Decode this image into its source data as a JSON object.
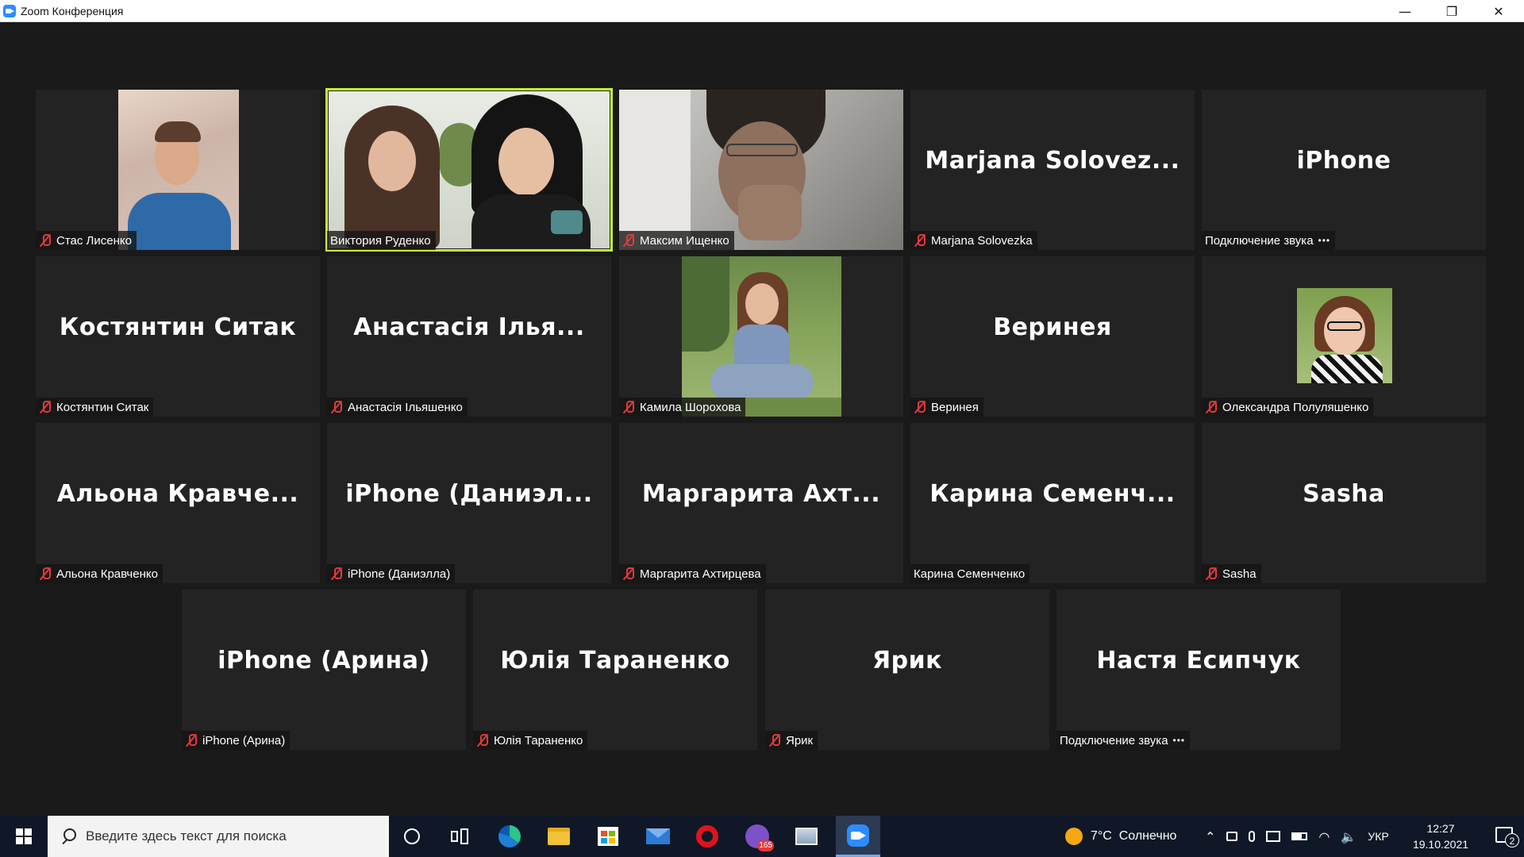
{
  "window": {
    "title": "Zoom Конференция",
    "minimize": "—",
    "restore": "❐",
    "close": "✕"
  },
  "accent_colors": {
    "active_speaker_border": "#c6f23a",
    "muted_icon": "#e5383b",
    "tile_bg": "#232323",
    "stage_bg": "#1a1a1a"
  },
  "tiles": [
    {
      "display_name": "",
      "label": "Стас Лисенко",
      "muted": true,
      "video": true
    },
    {
      "display_name": "",
      "label": "Виктория Руденко",
      "muted": false,
      "video": true,
      "active": true
    },
    {
      "display_name": "",
      "label": "Максим Ищенко",
      "muted": true,
      "video": true
    },
    {
      "display_name": "Marjana  Solovez...",
      "label": "Marjana Solovezka",
      "muted": true,
      "video": false
    },
    {
      "display_name": "iPhone",
      "label": "Подключение звука",
      "muted": false,
      "video": false,
      "connecting": true
    },
    {
      "display_name": "Костянтин Ситак",
      "label": "Костянтин Ситак",
      "muted": true,
      "video": false
    },
    {
      "display_name": "Анастасія Ілья...",
      "label": "Анастасія Ільяшенко",
      "muted": true,
      "video": false
    },
    {
      "display_name": "",
      "label": "Камила Шорохова",
      "muted": true,
      "video": true
    },
    {
      "display_name": "Веринея",
      "label": "Веринея",
      "muted": true,
      "video": false
    },
    {
      "display_name": "",
      "label": "Олександра Полуляшенко",
      "muted": true,
      "video": false,
      "avatar": true
    },
    {
      "display_name": "Альона  Кравче...",
      "label": "Альона Кравченко",
      "muted": true,
      "video": false
    },
    {
      "display_name": "iPhone  (Даниэл...",
      "label": "iPhone (Даниэлла)",
      "muted": true,
      "video": false
    },
    {
      "display_name": "Маргарита  Ахт...",
      "label": "Маргарита Ахтирцева",
      "muted": true,
      "video": false
    },
    {
      "display_name": "Карина  Семенч...",
      "label": "Карина Семенченко",
      "muted": false,
      "video": false
    },
    {
      "display_name": "Sasha",
      "label": "Sasha",
      "muted": true,
      "video": false
    },
    {
      "display_name": "iPhone (Арина)",
      "label": "iPhone (Арина)",
      "muted": true,
      "video": false
    },
    {
      "display_name": "Юлія Тараненко",
      "label": "Юлія Тараненко",
      "muted": true,
      "video": false
    },
    {
      "display_name": "Ярик",
      "label": "Ярик",
      "muted": true,
      "video": false
    },
    {
      "display_name": "Настя Есипчук",
      "label": "Подключение звука",
      "muted": false,
      "video": false,
      "connecting": true
    }
  ],
  "taskbar": {
    "search_placeholder": "Введите здесь текст для поиска",
    "apps": [
      "cortana-icon",
      "task-view-icon",
      "edge-icon",
      "file-explorer-icon",
      "store-icon",
      "mail-icon",
      "opera-icon",
      "viber-icon",
      "photos-icon",
      "zoom-icon"
    ],
    "viber_badge": "165",
    "weather": "7°C  Солнечно",
    "language": "УКР",
    "time": "12:27",
    "date": "19.10.2021",
    "notifications_count": "2"
  }
}
